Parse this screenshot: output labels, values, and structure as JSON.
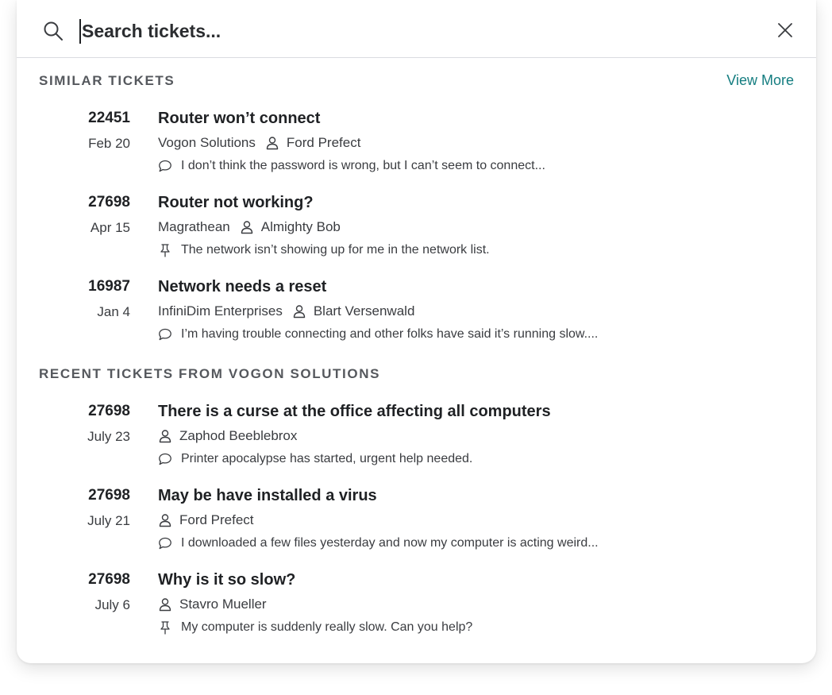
{
  "search": {
    "placeholder": "Search tickets...",
    "value": ""
  },
  "similar": {
    "heading": "SIMILAR TICKETS",
    "view_more": "View More",
    "tickets": [
      {
        "id": "22451",
        "date": "Feb 20",
        "title": "Router won’t connect",
        "company": "Vogon Solutions",
        "person": "Ford Prefect",
        "note_icon": "comment-icon",
        "note": "I don’t think the password is wrong, but I can’t seem to connect..."
      },
      {
        "id": "27698",
        "date": "Apr 15",
        "title": "Router not working?",
        "company": "Magrathean",
        "person": "Almighty Bob",
        "note_icon": "pin-icon",
        "note": "The network isn’t showing up for me in the network list."
      },
      {
        "id": "16987",
        "date": "Jan 4",
        "title": "Network needs a reset",
        "company": "InfiniDim Enterprises",
        "person": "Blart Versenwald",
        "note_icon": "comment-icon",
        "note": "I’m having trouble connecting and other folks have said it’s running slow...."
      }
    ]
  },
  "recent": {
    "heading": "RECENT TICKETS FROM VOGON SOLUTIONS",
    "tickets": [
      {
        "id": "27698",
        "date": "July 23",
        "title": "There is a curse at the office affecting all computers",
        "person": "Zaphod Beeblebrox",
        "note_icon": "comment-icon",
        "note": "Printer apocalypse has started, urgent help needed."
      },
      {
        "id": "27698",
        "date": "July 21",
        "title": "May be have installed a virus",
        "person": "Ford Prefect",
        "note_icon": "comment-icon",
        "note": "I downloaded a few files yesterday and now my computer is acting weird..."
      },
      {
        "id": "27698",
        "date": "July 6",
        "title": "Why is it so slow?",
        "person": "Stavro Mueller",
        "note_icon": "pin-icon",
        "note": "My computer is suddenly really slow. Can you help?"
      }
    ]
  },
  "colors": {
    "accent": "#147d80",
    "text": "#1f2124",
    "muted": "#3a3c40",
    "heading": "#55585d",
    "divider": "#dadce0"
  }
}
